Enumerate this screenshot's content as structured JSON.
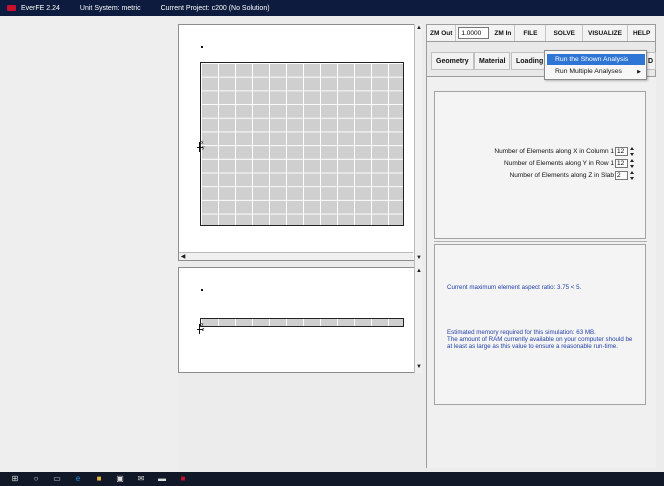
{
  "titlebar": {
    "app": "EverFE 2.24",
    "unit_system": "Unit System: metric",
    "project": "Current Project: c200 (No Solution)"
  },
  "toolbar": {
    "zoom_out": "ZM Out",
    "zoom_value": "1.0000",
    "zoom_in": "ZM In",
    "file": "FILE",
    "solve": "SOLVE",
    "visualize": "VISUALIZE",
    "help": "HELP"
  },
  "tabs": [
    "Geometry",
    "Material",
    "Loading",
    "D"
  ],
  "menu": {
    "item1": "Run the Shown Analysis",
    "item2": "Run Multiple Analyses"
  },
  "mesh_controls": {
    "x_label": "Number of Elements along X in Column 1",
    "x_value": "12",
    "y_label": "Number of Elements along Y in Row 1",
    "y_value": "12",
    "z_label": "Number of Elements along Z in Slab",
    "z_value": "2"
  },
  "info": {
    "aspect_ratio": "Current maximum element aspect ratio:   3.75 < 5.",
    "memory_line1": "Estimated memory required  for this simulation:    63 MB.",
    "memory_line2": "The amount of RAM currently available on your computer should be",
    "memory_line3": "at least as large as this value to ensure a reasonable run-time."
  },
  "viewport": {
    "plan_axes": [
      "x",
      "y"
    ],
    "elevation_axes": [
      "x",
      "z"
    ]
  },
  "colors": {
    "titlebar": "#0d1b3e",
    "menu_highlight": "#2f75d6",
    "info_text": "#2340a8"
  }
}
